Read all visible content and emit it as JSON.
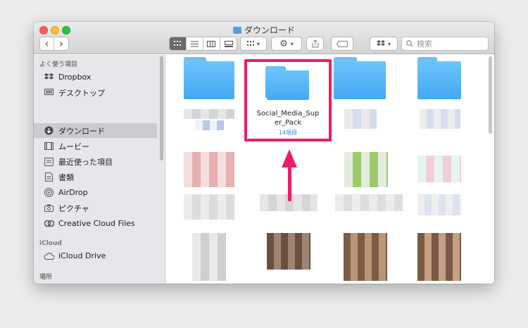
{
  "window": {
    "title": "ダウンロード"
  },
  "toolbar": {
    "back": "‹",
    "forward": "›",
    "arrange": "▾",
    "action": "▾",
    "dropbox": "▾",
    "search_placeholder": "検索"
  },
  "sidebar": {
    "sections": [
      {
        "label": "よく使う項目"
      },
      {
        "label": "iCloud"
      },
      {
        "label": "場所"
      }
    ],
    "favorites": [
      {
        "label": "Dropbox",
        "icon": "dropbox-icon"
      },
      {
        "label": "デスクトップ",
        "icon": "desktop-icon"
      },
      {
        "label": "ダウンロード",
        "icon": "downloads-icon",
        "selected": true
      },
      {
        "label": "ムービー",
        "icon": "movies-icon"
      },
      {
        "label": "最近使った項目",
        "icon": "recents-icon"
      },
      {
        "label": "書類",
        "icon": "documents-icon"
      },
      {
        "label": "AirDrop",
        "icon": "airdrop-icon"
      },
      {
        "label": "ピクチャ",
        "icon": "pictures-icon"
      },
      {
        "label": "Creative Cloud Files",
        "icon": "creative-cloud-icon"
      }
    ],
    "icloud": [
      {
        "label": "iCloud Drive",
        "icon": "cloud-icon"
      }
    ]
  },
  "content": {
    "highlighted_folder": {
      "name": "Social_Media_Super_Pack",
      "name_line1": "Social_Media_Sup",
      "name_line2": "er_Pack",
      "count": "14項目"
    }
  },
  "colors": {
    "highlight": "#ed1c6b",
    "folder": "#5bb6f8",
    "selection": "#cacacf"
  }
}
